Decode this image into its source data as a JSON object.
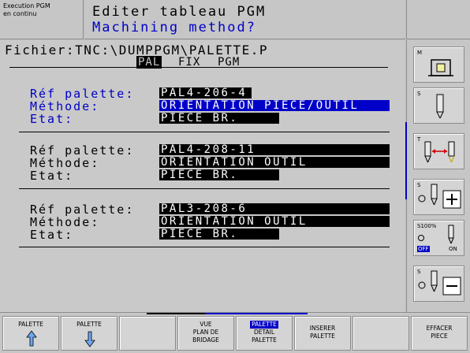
{
  "header": {
    "mode_line1": "Execution PGM",
    "mode_line2": "en continu",
    "title": "Editer tableau PGM",
    "subtitle": "Machining method?"
  },
  "file": {
    "path": "Fichier:TNC:\\DUMPPGM\\PALETTE.P"
  },
  "tabs": [
    {
      "label": "PAL",
      "active": true
    },
    {
      "label": "FIX",
      "active": false
    },
    {
      "label": "PGM",
      "active": false
    }
  ],
  "blocks": [
    {
      "ref_label": "Réf palette:",
      "ref_value": "PAL4-206-4",
      "method_label": "Méthode:",
      "method_value": "ORIENTATION PIECE/OUTIL",
      "state_label": "Etat:",
      "state_value": "PIECE BR."
    },
    {
      "ref_label": "Réf palette:",
      "ref_value": "PAL4-208-11",
      "method_label": "Méthode:",
      "method_value": "ORIENTATION OUTIL",
      "state_label": "Etat:",
      "state_value": "PIECE BR."
    },
    {
      "ref_label": "Réf palette:",
      "ref_value": "PAL3-208-6",
      "method_label": "Méthode:",
      "method_value": "ORIENTATION OUTIL",
      "state_label": "Etat:",
      "state_value": "PIECE BR."
    }
  ],
  "side": {
    "m_label": "M",
    "s_label": "S",
    "t_label": "T",
    "s2_label": "S",
    "s100_label": "S100%",
    "off_label": "OFF",
    "on_label": "ON",
    "s3_label": "S"
  },
  "softkeys": {
    "k1": "PALETTE",
    "k2": "PALETTE",
    "k4_l1": "VUE",
    "k4_l2": "PLAN DE",
    "k4_l3": "BRIDAGE",
    "k5_l1": "PALETTE",
    "k5_l2": "DETAIL",
    "k5_l3": "PALETTE",
    "k6_l1": "INSERER",
    "k6_l2": "PALETTE",
    "k8_l1": "EFFACER",
    "k8_l2": "PIECE"
  },
  "colors": {
    "accent": "#0000c8",
    "background": "#c9c9c9",
    "value_bg": "#000000"
  }
}
